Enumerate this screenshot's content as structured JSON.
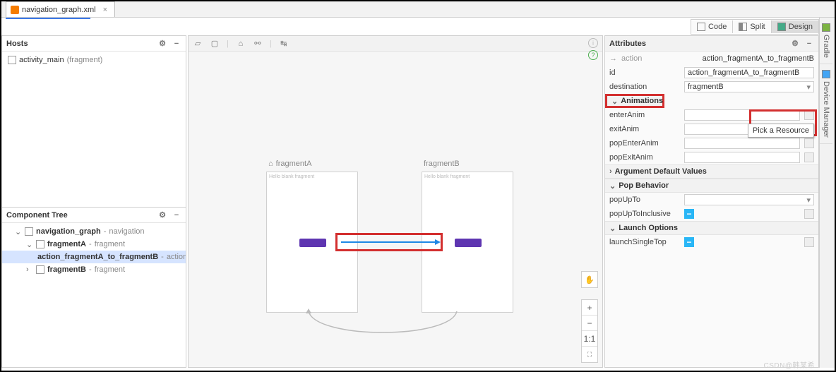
{
  "tab": {
    "filename": "navigation_graph.xml"
  },
  "modes": {
    "code": "Code",
    "split": "Split",
    "design": "Design"
  },
  "hosts": {
    "title": "Hosts",
    "items": [
      {
        "name": "activity_main",
        "suffix": "(fragment)"
      }
    ]
  },
  "componentTree": {
    "title": "Component Tree",
    "nav": {
      "name": "navigation_graph",
      "type": "navigation"
    },
    "fragA": {
      "name": "fragmentA",
      "type": "fragment"
    },
    "action": {
      "name": "action_fragmentA_to_fragmentB",
      "type": "action"
    },
    "fragB": {
      "name": "fragmentB",
      "type": "fragment"
    }
  },
  "canvas": {
    "fragA": {
      "title": "fragmentA",
      "innertext": "Hello blank fragment"
    },
    "fragB": {
      "title": "fragmentB",
      "innertext": "Hello blank fragment"
    }
  },
  "attributes": {
    "title": "Attributes",
    "actionArrow": "→",
    "actionName": "action",
    "selectedName": "action_fragmentA_to_fragmentB",
    "id": {
      "label": "id",
      "value": "action_fragmentA_to_fragmentB"
    },
    "destination": {
      "label": "destination",
      "value": "fragmentB"
    },
    "sections": {
      "animations": "Animations",
      "argDefault": "Argument Default Values",
      "popBehavior": "Pop Behavior",
      "launchOptions": "Launch Options"
    },
    "enterAnim": {
      "label": "enterAnim"
    },
    "exitAnim": {
      "label": "exitAnim"
    },
    "popEnterAnim": {
      "label": "popEnterAnim"
    },
    "popExitAnim": {
      "label": "popExitAnim"
    },
    "popUpTo": {
      "label": "popUpTo"
    },
    "popUpToInclusive": {
      "label": "popUpToInclusive"
    },
    "launchSingleTop": {
      "label": "launchSingleTop"
    },
    "tooltip": "Pick a Resource"
  },
  "zoom": {
    "plus": "+",
    "minus": "−",
    "oneone": "1:1",
    "fit": "⛶"
  },
  "sidetabs": {
    "gradle": "Gradle",
    "device": "Device Manager"
  },
  "watermark": "CSDN@韩某希"
}
